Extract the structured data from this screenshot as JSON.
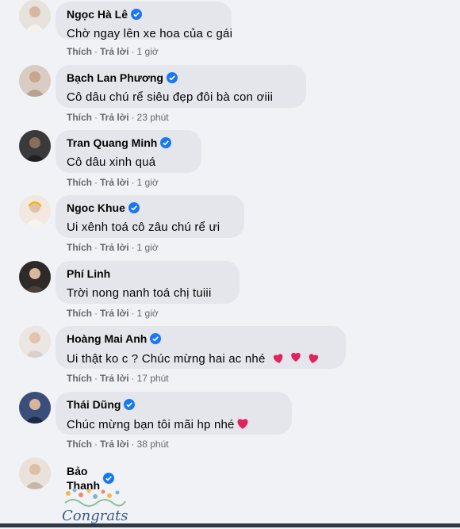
{
  "comments": [
    {
      "author": "Ngọc Hà Lê",
      "verified": true,
      "text": "Chờ ngay lên xe hoa của c gái",
      "like": "Thích",
      "reply": "Trả lời",
      "time": "1 giờ"
    },
    {
      "author": "Bạch Lan Phương",
      "verified": true,
      "text": "Cô dâu chú rể siêu đẹp đôi bà con ơiii",
      "like": "Thích",
      "reply": "Trả lời",
      "time": "23 phút"
    },
    {
      "author": "Tran Quang Minh",
      "verified": true,
      "text": "Cô dâu xinh quá",
      "like": "Thích",
      "reply": "Trả lời",
      "time": "1 giờ"
    },
    {
      "author": "Ngoc Khue",
      "verified": true,
      "text": "Ui xênh toá cô zâu chú rể ưi",
      "like": "Thích",
      "reply": "Trả lời",
      "time": "1 giờ"
    },
    {
      "author": "Phí Linh",
      "verified": false,
      "text": "Trời nong nanh toá chị tuiii",
      "like": "Thích",
      "reply": "Trả lời",
      "time": "1 giờ"
    },
    {
      "author": "Hoàng Mai Anh",
      "verified": true,
      "text": "Ui thật ko c ? Chúc mừng hai ac nhé",
      "like": "Thích",
      "reply": "Trả lời",
      "time": "17 phút"
    },
    {
      "author": "Thái Dũng",
      "verified": true,
      "text": "Chúc mừng bạn tôi mãi hp nhé",
      "like": "Thích",
      "reply": "Trả lời",
      "time": "38 phút"
    },
    {
      "author": "Bảo Thanh",
      "verified": true,
      "text": "",
      "like": "",
      "reply": "",
      "time": ""
    }
  ],
  "sticker_text": "Congrats",
  "colors": {
    "bubble": "#e4e6eb",
    "verified": "#1877f2",
    "heart": "#e0245e",
    "meta": "#65676b"
  }
}
